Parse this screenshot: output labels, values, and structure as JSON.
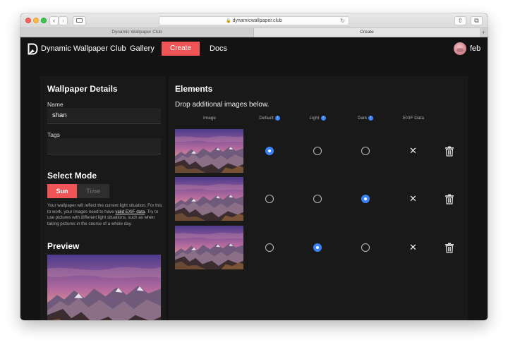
{
  "browser": {
    "url": "dynamicwallpaper.club",
    "tabs": [
      "Dynamic Wallpaper Club",
      "Create"
    ],
    "new_tab_symbol": "+"
  },
  "nav": {
    "brand": "Dynamic Wallpaper Club",
    "gallery": "Gallery",
    "create": "Create",
    "docs": "Docs",
    "username": "feb"
  },
  "details": {
    "title": "Wallpaper Details",
    "name_label": "Name",
    "name_value": "shan",
    "tags_label": "Tags",
    "tags_value": ""
  },
  "mode": {
    "title": "Select Mode",
    "sun": "Sun",
    "time": "Time",
    "selected": "Sun",
    "help_before": "Your wallpaper will reflect the current light situation. For this to work, your images need to have ",
    "help_link": "valid EXIF data",
    "help_after": ". Try to use pictures with different light situations, such as when taking pictures in the course of a whole day."
  },
  "preview": {
    "title": "Preview"
  },
  "elements": {
    "title": "Elements",
    "drop_text": "Drop additional images below.",
    "columns": [
      "Image",
      "Default",
      "Light",
      "Dark",
      "EXIF Data"
    ],
    "info_symbol": "i",
    "rows": [
      {
        "default": true,
        "light": false,
        "dark": false,
        "exif": "✕"
      },
      {
        "default": false,
        "light": false,
        "dark": true,
        "exif": "✕"
      },
      {
        "default": false,
        "light": true,
        "dark": false,
        "exif": "✕"
      }
    ]
  },
  "colors": {
    "accent": "#ef5556",
    "radio_selected": "#3b82f6",
    "background": "#131313",
    "panel": "#191919"
  },
  "icons": {
    "logo": "dynamic-wallpaper-logo-icon",
    "delete": "trash-icon",
    "exif_missing": "close-icon",
    "info": "info-icon"
  }
}
